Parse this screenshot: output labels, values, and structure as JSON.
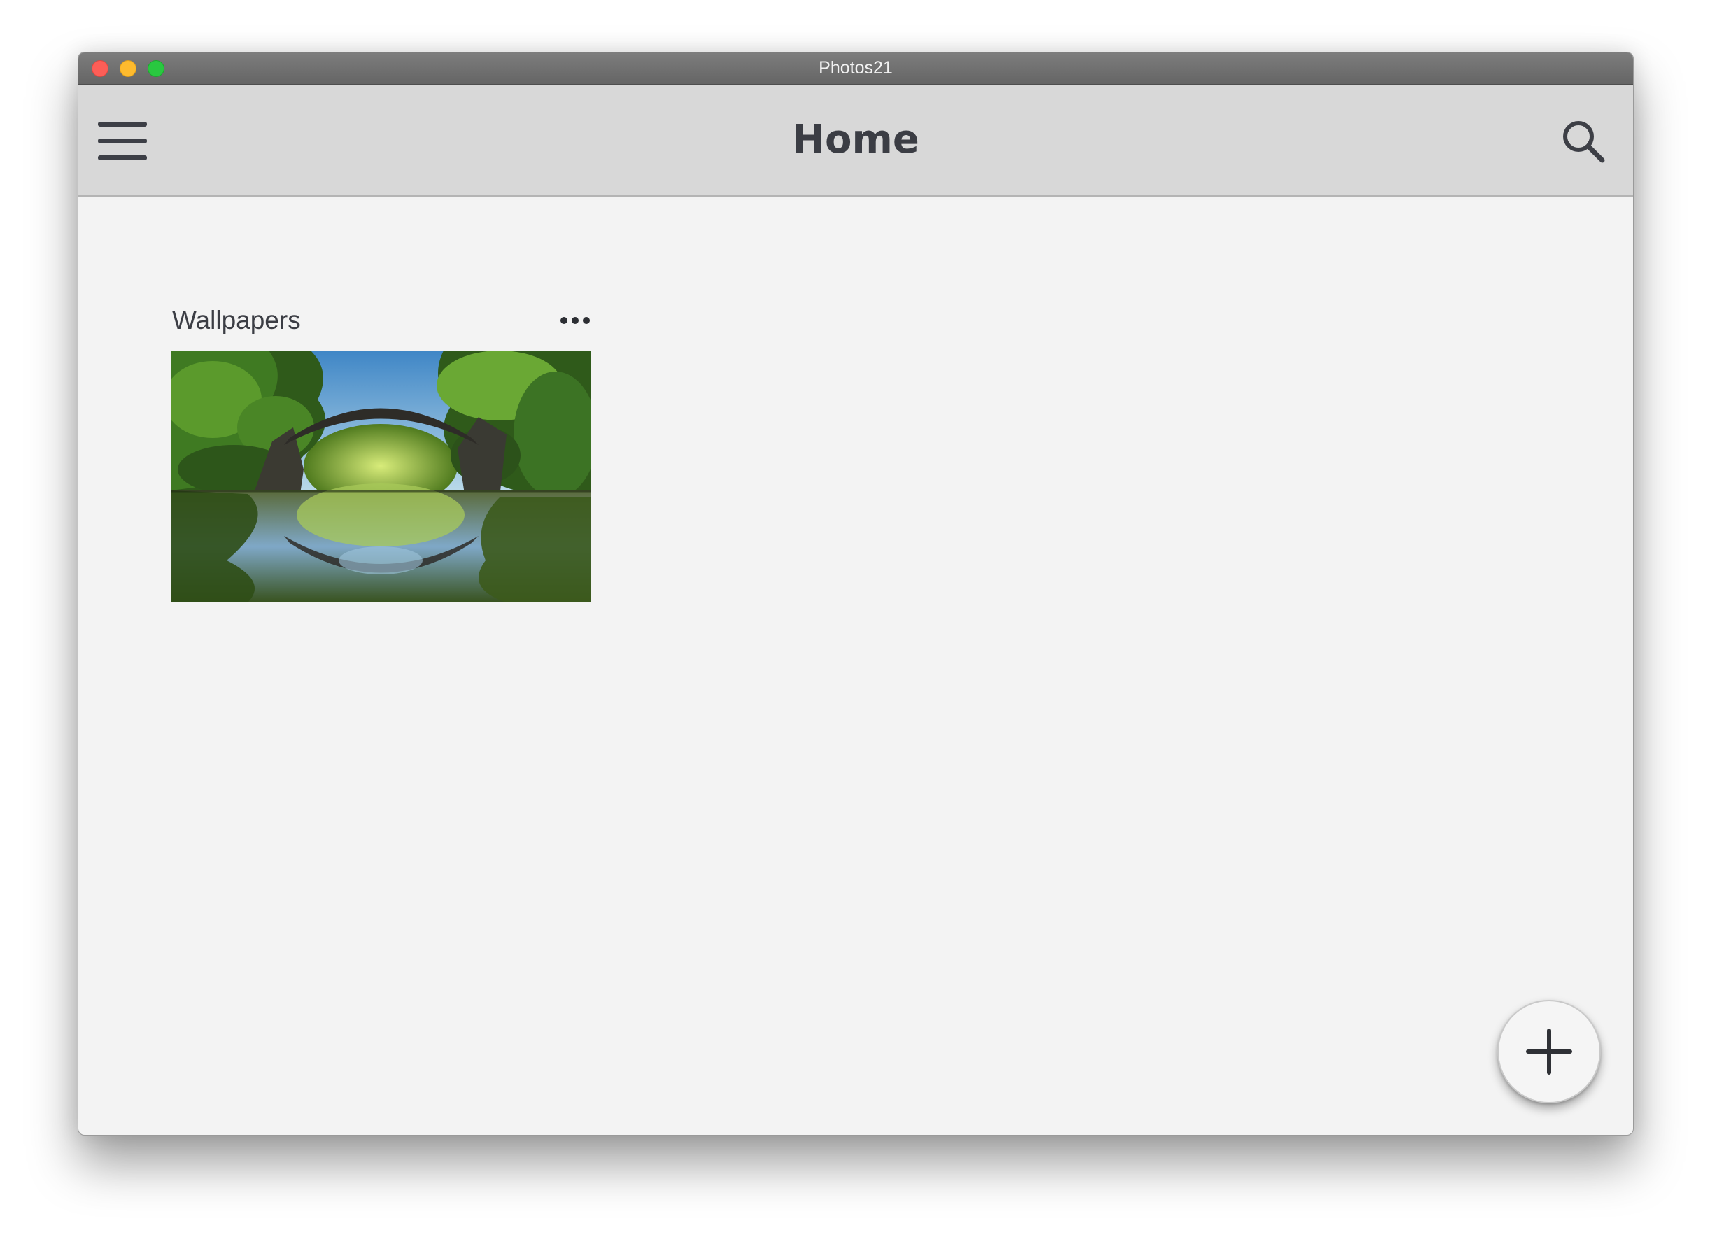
{
  "window": {
    "title": "Photos21"
  },
  "appbar": {
    "title": "Home",
    "menu_icon": "hamburger-menu-icon",
    "search_icon": "search-icon"
  },
  "albums": [
    {
      "name": "Wallpapers",
      "more_icon": "more-horizontal-icon",
      "thumbnail": "stone-arch-bridge-reflected-in-forest-lake"
    }
  ],
  "fab": {
    "icon": "plus-icon"
  },
  "colors": {
    "appbar_background": "#d8d8d8",
    "content_background": "#f3f3f3",
    "text_primary": "#3b3d44",
    "titlebar": "#707070",
    "traffic_close": "#fd5e57",
    "traffic_minimize": "#febb2e",
    "traffic_maximize": "#29c840"
  }
}
